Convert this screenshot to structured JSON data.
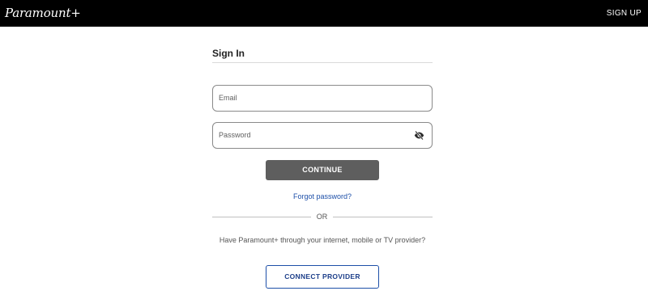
{
  "header": {
    "logo_text": "Paramount+",
    "signup_label": "SIGN UP"
  },
  "signin": {
    "title": "Sign In",
    "email_placeholder": "Email",
    "password_placeholder": "Password",
    "continue_label": "CONTINUE",
    "forgot_label": "Forgot password?",
    "or_label": "OR",
    "provider_text": "Have Paramount+ through your internet, mobile or TV provider?",
    "connect_label": "CONNECT PROVIDER"
  },
  "icons": {
    "password_toggle": "eye-slash-icon"
  },
  "colors": {
    "topbar": "#000000",
    "link": "#1d4fa8",
    "continue_bg": "#5e5e5e",
    "field_border": "#8a8a8a"
  }
}
